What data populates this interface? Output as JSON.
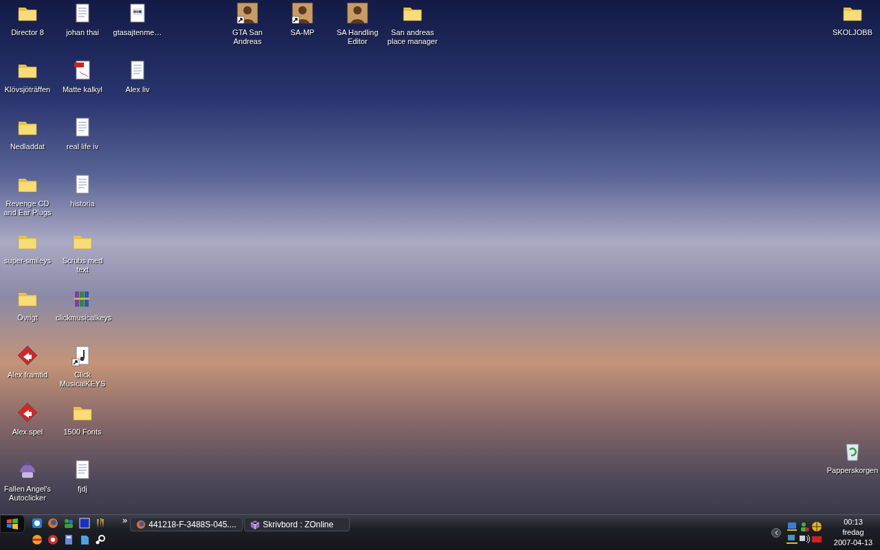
{
  "desktop": {
    "left_columns": [
      {
        "icons": [
          {
            "label": "Director 8",
            "kind": "folder",
            "shortcut": false
          },
          {
            "label": "Klövsjöträffen",
            "kind": "folder",
            "shortcut": false
          },
          {
            "label": "Nedladdat",
            "kind": "folder",
            "shortcut": false
          },
          {
            "label": "Revenge CD and Ear Plugs",
            "kind": "folder",
            "shortcut": false
          },
          {
            "label": "super-smileys",
            "kind": "folder",
            "shortcut": false
          },
          {
            "label": "Övrigt",
            "kind": "folder",
            "shortcut": false
          },
          {
            "label": "Alex framtid",
            "kind": "diamond",
            "shortcut": false
          },
          {
            "label": "Alex spel",
            "kind": "diamond",
            "shortcut": false
          },
          {
            "label": "Fallen Angel's Autoclicker",
            "kind": "dome",
            "shortcut": false
          }
        ]
      },
      {
        "icons": [
          {
            "label": "johan thai",
            "kind": "text",
            "shortcut": false
          },
          {
            "label": "Matte kalkyl",
            "kind": "pdf",
            "shortcut": false
          },
          {
            "label": "real life iv",
            "kind": "text",
            "shortcut": false
          },
          {
            "label": "historia",
            "kind": "text",
            "shortcut": false
          },
          {
            "label": "Scrubs med text",
            "kind": "folder",
            "shortcut": false
          },
          {
            "label": "clickmusicalkeys",
            "kind": "archive",
            "shortcut": false
          },
          {
            "label": "Click MusicalKEYS",
            "kind": "music",
            "shortcut": true
          },
          {
            "label": "1500 Fonts",
            "kind": "folder",
            "shortcut": false
          },
          {
            "label": "fjdj",
            "kind": "text",
            "shortcut": false
          }
        ]
      },
      {
        "icons": [
          {
            "label": "gtasajtenme…",
            "kind": "webpage",
            "shortcut": false
          },
          {
            "label": "Alex liv",
            "kind": "text",
            "shortcut": false
          }
        ]
      }
    ],
    "top_row": [
      {
        "label": "GTA San Andreas",
        "kind": "portrait",
        "shortcut": true
      },
      {
        "label": "SA-MP",
        "kind": "portrait",
        "shortcut": true
      },
      {
        "label": "SA Handling Editor",
        "kind": "portrait",
        "shortcut": false
      },
      {
        "label": "San andreas place manager",
        "kind": "folder",
        "shortcut": false
      }
    ],
    "right_column": [
      {
        "label": "SKOLJOBB",
        "kind": "folder",
        "shortcut": false
      },
      {
        "label": "Papperskorgen",
        "kind": "recycle",
        "shortcut": false
      }
    ]
  },
  "taskbar": {
    "chevron": "»",
    "tasks": [
      {
        "title": "441218-F-3488S-045....",
        "kind": "browser"
      },
      {
        "title": "Skrivbord : ZOnline",
        "kind": "cube"
      }
    ],
    "clock": {
      "time": "00:13",
      "day": "fredag",
      "date": "2007-04-13"
    }
  }
}
